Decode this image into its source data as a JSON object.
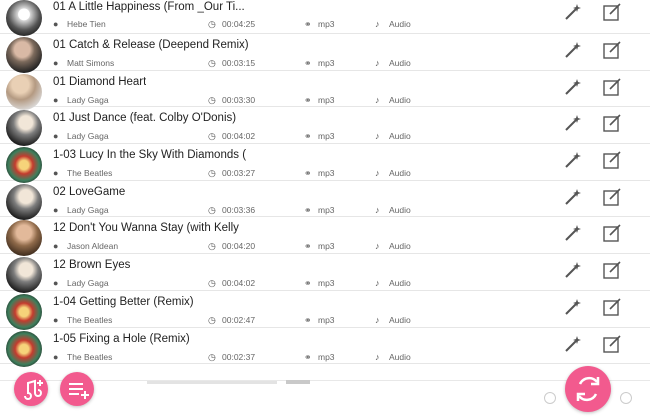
{
  "tracks": [
    {
      "title": "01 A Little Happiness (From _Our Ti...",
      "artist": "Hebe Tien",
      "duration": "00:04:25",
      "format": "mp3",
      "type": "Audio"
    },
    {
      "title": "01 Catch & Release (Deepend Remix)",
      "artist": "Matt Simons",
      "duration": "00:03:15",
      "format": "mp3",
      "type": "Audio"
    },
    {
      "title": "01 Diamond Heart",
      "artist": "Lady Gaga",
      "duration": "00:03:30",
      "format": "mp3",
      "type": "Audio"
    },
    {
      "title": "01 Just Dance (feat. Colby O'Donis)",
      "artist": "Lady Gaga",
      "duration": "00:04:02",
      "format": "mp3",
      "type": "Audio"
    },
    {
      "title": "1-03 Lucy In the Sky With Diamonds (",
      "artist": "The Beatles",
      "duration": "00:03:27",
      "format": "mp3",
      "type": "Audio"
    },
    {
      "title": "02 LoveGame",
      "artist": "Lady Gaga",
      "duration": "00:03:36",
      "format": "mp3",
      "type": "Audio"
    },
    {
      "title": "12 Don't You Wanna Stay (with Kelly",
      "artist": "Jason Aldean",
      "duration": "00:04:20",
      "format": "mp3",
      "type": "Audio"
    },
    {
      "title": "12 Brown Eyes",
      "artist": "Lady Gaga",
      "duration": "00:04:02",
      "format": "mp3",
      "type": "Audio"
    },
    {
      "title": "1-04 Getting Better (Remix)",
      "artist": "The Beatles",
      "duration": "00:02:47",
      "format": "mp3",
      "type": "Audio"
    },
    {
      "title": "1-05 Fixing a Hole (Remix)",
      "artist": "The Beatles",
      "duration": "00:02:37",
      "format": "mp3",
      "type": "Audio"
    }
  ],
  "colors": {
    "accent": "#f25a8e",
    "icon": "#555555"
  },
  "icons": {
    "artist": "person-icon",
    "duration": "clock-icon",
    "format": "headphones-icon",
    "type": "music-note-icon",
    "enhance": "magic-wand-icon",
    "edit": "edit-icon"
  }
}
